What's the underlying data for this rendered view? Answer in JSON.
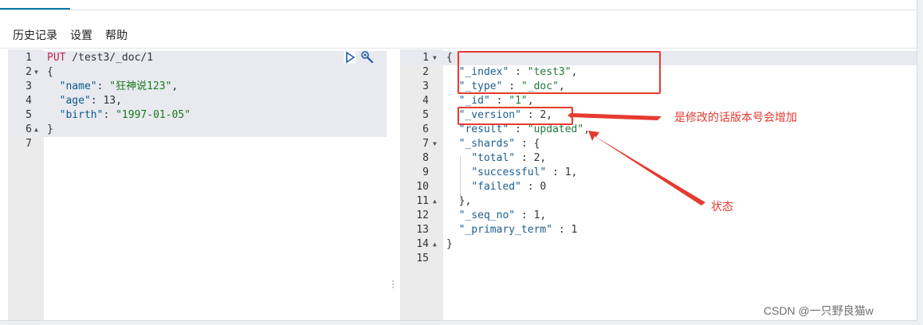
{
  "menu": {
    "history": "历史记录",
    "settings": "设置",
    "help": "帮助"
  },
  "request": {
    "lines": [
      {
        "n": "1",
        "fold": "",
        "parts": [
          [
            "tk-method",
            "PUT"
          ],
          [
            "tk-punc",
            " /test3/_doc/1"
          ]
        ]
      },
      {
        "n": "2",
        "fold": "▼",
        "parts": [
          [
            "tk-punc",
            "{"
          ]
        ]
      },
      {
        "n": "3",
        "fold": "",
        "parts": [
          [
            "tk-punc",
            "  "
          ],
          [
            "tk-key",
            "\"name\""
          ],
          [
            "tk-punc",
            ": "
          ],
          [
            "tk-str",
            "\"狂神说123\""
          ],
          [
            "tk-punc",
            ","
          ]
        ]
      },
      {
        "n": "4",
        "fold": "",
        "parts": [
          [
            "tk-punc",
            "  "
          ],
          [
            "tk-key",
            "\"age\""
          ],
          [
            "tk-punc",
            ": 13,"
          ]
        ]
      },
      {
        "n": "5",
        "fold": "",
        "parts": [
          [
            "tk-punc",
            "  "
          ],
          [
            "tk-key",
            "\"birth\""
          ],
          [
            "tk-punc",
            ": "
          ],
          [
            "tk-str",
            "\"1997-01-05\""
          ]
        ]
      },
      {
        "n": "6",
        "fold": "▲",
        "parts": [
          [
            "tk-punc",
            "}"
          ]
        ]
      },
      {
        "n": "7",
        "fold": "",
        "parts": []
      }
    ]
  },
  "response": {
    "lines": [
      {
        "n": "1",
        "fold": "▼",
        "parts": [
          [
            "tk-punc",
            "{"
          ]
        ]
      },
      {
        "n": "2",
        "fold": "",
        "parts": [
          [
            "tk-punc",
            "  "
          ],
          [
            "tk-rkey",
            "\"_index\""
          ],
          [
            "tk-punc",
            " : "
          ],
          [
            "tk-rstr",
            "\"test3\""
          ],
          [
            "tk-punc",
            ","
          ]
        ]
      },
      {
        "n": "3",
        "fold": "",
        "parts": [
          [
            "tk-punc",
            "  "
          ],
          [
            "tk-rkey",
            "\"_type\""
          ],
          [
            "tk-punc",
            " : "
          ],
          [
            "tk-rstr",
            "\"_doc\""
          ],
          [
            "tk-punc",
            ","
          ]
        ]
      },
      {
        "n": "4",
        "fold": "",
        "parts": [
          [
            "tk-punc",
            "  "
          ],
          [
            "tk-rkey",
            "\"_id\""
          ],
          [
            "tk-punc",
            " : "
          ],
          [
            "tk-rstr",
            "\"1\""
          ],
          [
            "tk-punc",
            ","
          ]
        ]
      },
      {
        "n": "5",
        "fold": "",
        "parts": [
          [
            "tk-punc",
            "  "
          ],
          [
            "tk-rkey",
            "\"_version\""
          ],
          [
            "tk-punc",
            " : 2,"
          ]
        ]
      },
      {
        "n": "6",
        "fold": "",
        "parts": [
          [
            "tk-punc",
            "  "
          ],
          [
            "tk-rkey",
            "\"result\""
          ],
          [
            "tk-punc",
            " : "
          ],
          [
            "tk-rstr",
            "\"updated\""
          ],
          [
            "tk-punc",
            ","
          ]
        ]
      },
      {
        "n": "7",
        "fold": "▼",
        "parts": [
          [
            "tk-punc",
            "  "
          ],
          [
            "tk-rkey",
            "\"_shards\""
          ],
          [
            "tk-punc",
            " : {"
          ]
        ]
      },
      {
        "n": "8",
        "fold": "",
        "parts": [
          [
            "tk-punc",
            "    "
          ],
          [
            "tk-rkey",
            "\"total\""
          ],
          [
            "tk-punc",
            " : 2,"
          ]
        ]
      },
      {
        "n": "9",
        "fold": "",
        "parts": [
          [
            "tk-punc",
            "    "
          ],
          [
            "tk-rkey",
            "\"successful\""
          ],
          [
            "tk-punc",
            " : 1,"
          ]
        ]
      },
      {
        "n": "10",
        "fold": "",
        "parts": [
          [
            "tk-punc",
            "    "
          ],
          [
            "tk-rkey",
            "\"failed\""
          ],
          [
            "tk-punc",
            " : 0"
          ]
        ]
      },
      {
        "n": "11",
        "fold": "▲",
        "parts": [
          [
            "tk-punc",
            "  },"
          ]
        ]
      },
      {
        "n": "12",
        "fold": "",
        "parts": [
          [
            "tk-punc",
            "  "
          ],
          [
            "tk-rkey",
            "\"_seq_no\""
          ],
          [
            "tk-punc",
            " : 1,"
          ]
        ]
      },
      {
        "n": "13",
        "fold": "",
        "parts": [
          [
            "tk-punc",
            "  "
          ],
          [
            "tk-rkey",
            "\"_primary_term\""
          ],
          [
            "tk-punc",
            " : 1"
          ]
        ]
      },
      {
        "n": "14",
        "fold": "▲",
        "parts": [
          [
            "tk-punc",
            "}"
          ]
        ]
      },
      {
        "n": "15",
        "fold": "",
        "parts": []
      }
    ]
  },
  "annotations": {
    "version_note": "是修改的话版本号会增加",
    "status_note": "状态"
  },
  "watermark": "CSDN @一只野良猫w",
  "colors": {
    "annotation_red": "#e53b31",
    "tab_accent": "#0079a5"
  },
  "icons": {
    "run": "play-icon",
    "tools": "wrench-icon"
  }
}
